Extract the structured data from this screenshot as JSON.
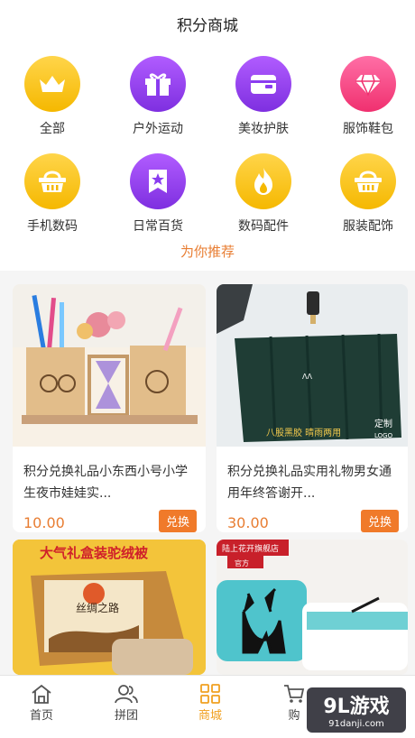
{
  "header": {
    "title": "积分商城"
  },
  "categories": [
    {
      "label": "全部",
      "icon": "crown-icon"
    },
    {
      "label": "户外运动",
      "icon": "gift-icon"
    },
    {
      "label": "美妆护肤",
      "icon": "wallet-icon"
    },
    {
      "label": "服饰鞋包",
      "icon": "diamond-icon"
    },
    {
      "label": "手机数码",
      "icon": "basket-icon"
    },
    {
      "label": "日常百货",
      "icon": "star-bookmark-icon"
    },
    {
      "label": "数码配件",
      "icon": "flame-icon"
    },
    {
      "label": "服装配饰",
      "icon": "basket-icon"
    }
  ],
  "recommend_label": "为你推荐",
  "products": [
    {
      "title": "积分兑换礼品小东西小号小学生夜市娃娃实...",
      "price": "10.00",
      "button": "兑换"
    },
    {
      "title": "积分兑换礼品实用礼物男女通用年终答谢开...",
      "price": "30.00",
      "button": "兑换"
    },
    {
      "banner_text": "大气礼盒装驼绒被",
      "box_text": "丝绸之路"
    },
    {
      "banner_text": "陆上花开旗舰店",
      "banner_sub": "官方"
    }
  ],
  "umbrella_labels": {
    "a": "八股黑胶 晴雨两用",
    "b": "定制",
    "c": "LOGO"
  },
  "tabs": [
    {
      "label": "首页"
    },
    {
      "label": "拼团"
    },
    {
      "label": "商城"
    },
    {
      "label": "购"
    }
  ],
  "watermark": {
    "big": "9L游戏",
    "small": "91danji.com"
  },
  "colors": {
    "accent": "#e87d32",
    "yellow": "#f5b800",
    "purple": "#8a3cf0",
    "pink": "#f0306f",
    "active_tab": "#f0a020"
  }
}
